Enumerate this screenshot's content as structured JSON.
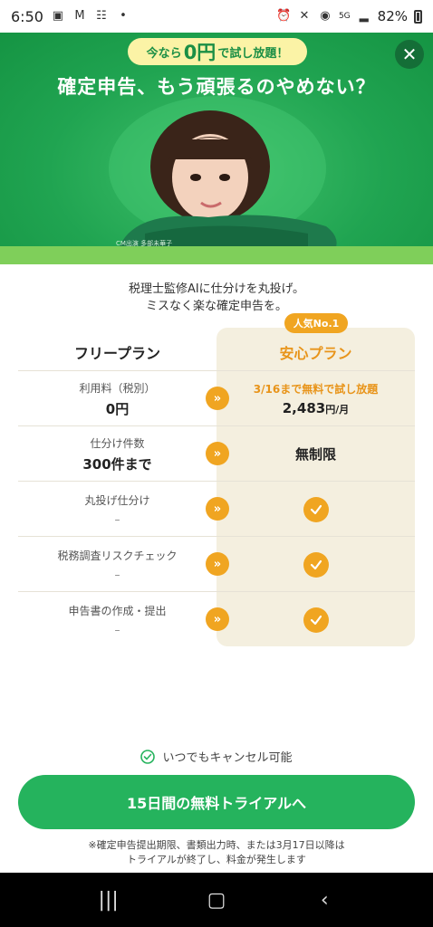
{
  "status_bar": {
    "time": "6:50",
    "network": "5G",
    "battery": "82%"
  },
  "hero": {
    "promo_prefix": "今なら",
    "promo_highlight": "0円",
    "promo_suffix": "で試し放題！",
    "title": "確定申告、もう頑張るのやめない？",
    "credit": "CM出演 多部未華子"
  },
  "subtitle": {
    "line1": "税理士監修AIに仕分けを丸投げ。",
    "line2": "ミスなく楽な確定申告を。"
  },
  "comparison": {
    "badge": "人気No.1",
    "free_plan_name": "フリープラン",
    "paid_plan_name": "安心プラン",
    "rows": [
      {
        "label": "利用料（税別）",
        "free": "0円",
        "trial_note": "3/16まで無料で試し放題",
        "paid_price": "2,483",
        "paid_unit": "円/月"
      },
      {
        "label": "仕分け件数",
        "free": "300件まで",
        "paid": "無制限"
      },
      {
        "label": "丸投げ仕分け",
        "free": "–"
      },
      {
        "label": "税務調査リスクチェック",
        "free": "–"
      },
      {
        "label": "申告書の作成・提出",
        "free": "–"
      }
    ]
  },
  "footer": {
    "cancel_text": "いつでもキャンセル可能",
    "cta_label": "15日間の無料トライアルへ",
    "note_line1": "※確定申告提出期限、書類出力時、または3月17日以降は",
    "note_line2": "トライアルが終了し、料金が発生します"
  },
  "colors": {
    "brand_green": "#25b35d",
    "accent_orange": "#f0a521",
    "plan_bg": "#f4efdf"
  }
}
